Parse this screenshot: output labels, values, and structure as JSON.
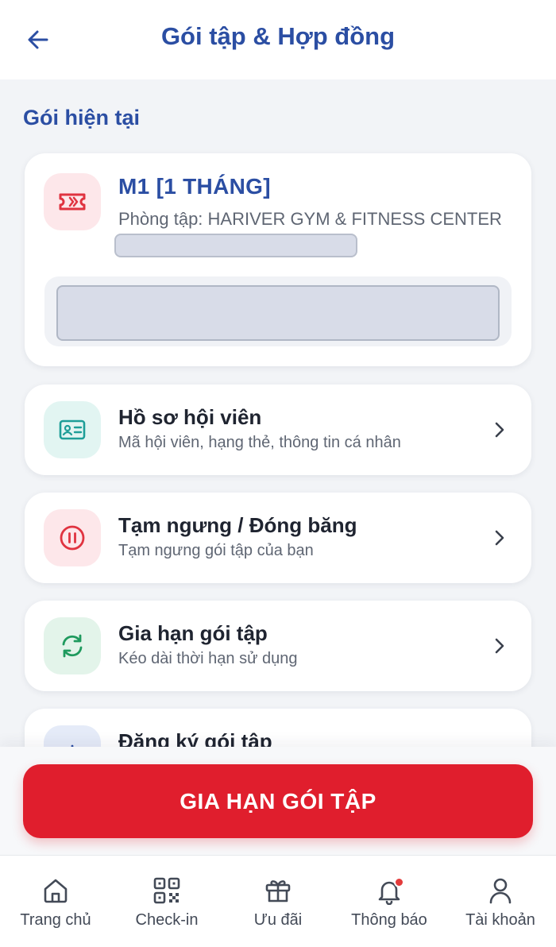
{
  "header": {
    "title": "Gói tập & Hợp đồng",
    "back_icon": "arrow-left-icon"
  },
  "section": {
    "title": "Gói hiện tại"
  },
  "plan": {
    "name": "M1 [1 THÁNG]",
    "gym": "Phòng tập: HARIVER GYM & FITNESS CENTER",
    "icon": "ticket-icon"
  },
  "menu": [
    {
      "title": "Hồ sơ hội viên",
      "subtitle": "Mã hội viên, hạng thẻ, thông tin cá nhân",
      "icon": "id-card-icon"
    },
    {
      "title": "Tạm ngưng / Đóng băng",
      "subtitle": "Tạm ngưng gói tập của bạn",
      "icon": "pause-icon"
    },
    {
      "title": "Gia hạn gói tập",
      "subtitle": "Kéo dài thời hạn sử dụng",
      "icon": "refresh-icon"
    },
    {
      "title": "Đăng ký gói tập",
      "icon": "plus-icon"
    }
  ],
  "cta": {
    "label": "GIA HẠN GÓI TẬP"
  },
  "tabs": [
    {
      "label": "Trang chủ",
      "icon": "home-icon"
    },
    {
      "label": "Check-in",
      "icon": "qr-code-icon"
    },
    {
      "label": "Ưu đãi",
      "icon": "gift-icon"
    },
    {
      "label": "Thông báo",
      "icon": "bell-icon"
    },
    {
      "label": "Tài khoản",
      "icon": "user-icon"
    }
  ],
  "colors": {
    "primary": "#2b4ea3",
    "accent_red": "#e01e2d",
    "icon_red": "#e03340",
    "icon_teal": "#1e9e98",
    "icon_green": "#1f9a5e",
    "background": "#f2f4f7"
  }
}
